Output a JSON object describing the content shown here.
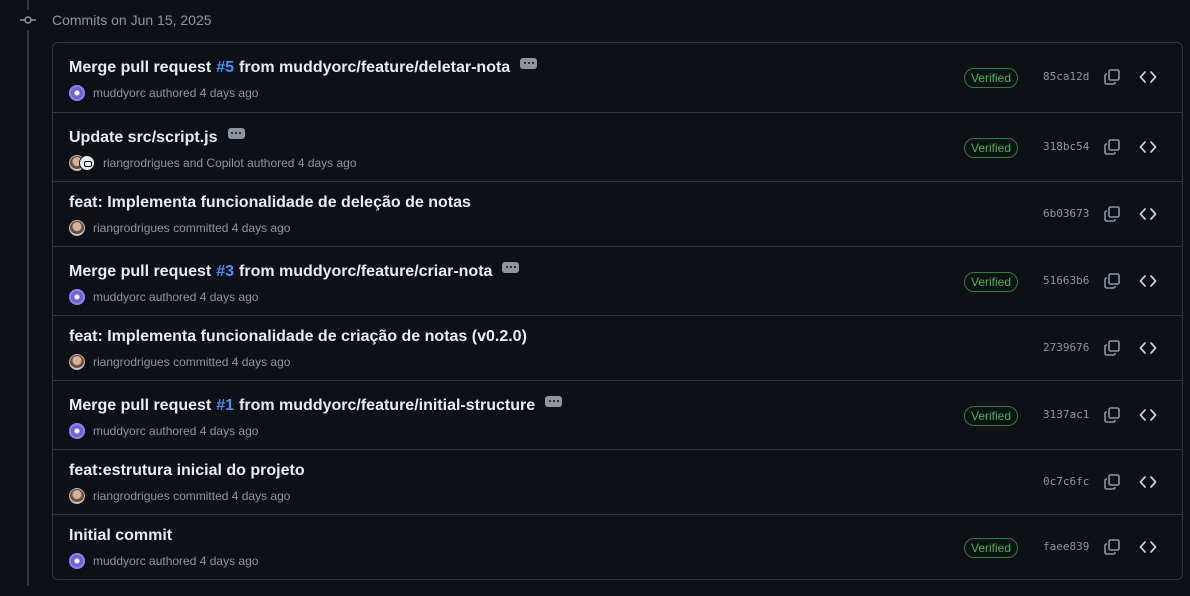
{
  "group": {
    "date_label": "Commits on Jun 15, 2025"
  },
  "commits": [
    {
      "title_before": "Merge pull request",
      "pr": "#5",
      "title_after": "from muddyorc/feature/deletar-nota",
      "has_ellipsis": true,
      "authors": "muddyorc",
      "action": "authored 4 days ago",
      "avatar": "muddy",
      "verified": "Verified",
      "sha": "85ca12d"
    },
    {
      "title_before": "Update src/script.js",
      "pr": "",
      "title_after": "",
      "has_ellipsis": true,
      "authors": "riangrodrigues and Copilot",
      "action": "authored 4 days ago",
      "avatar": "rian+copilot",
      "verified": "Verified",
      "sha": "318bc54"
    },
    {
      "title_before": "feat: Implementa funcionalidade de deleção de notas",
      "pr": "",
      "title_after": "",
      "has_ellipsis": false,
      "authors": "riangrodrigues",
      "action": "committed 4 days ago",
      "avatar": "rian",
      "verified": "",
      "sha": "6b03673"
    },
    {
      "title_before": "Merge pull request",
      "pr": "#3",
      "title_after": "from muddyorc/feature/criar-nota",
      "has_ellipsis": true,
      "authors": "muddyorc",
      "action": "authored 4 days ago",
      "avatar": "muddy",
      "verified": "Verified",
      "sha": "51663b6"
    },
    {
      "title_before": "feat: Implementa funcionalidade de criação de notas (v0.2.0)",
      "pr": "",
      "title_after": "",
      "has_ellipsis": false,
      "authors": "riangrodrigues",
      "action": "committed 4 days ago",
      "avatar": "rian",
      "verified": "",
      "sha": "2739676"
    },
    {
      "title_before": "Merge pull request",
      "pr": "#1",
      "title_after": "from muddyorc/feature/initial-structure",
      "has_ellipsis": true,
      "authors": "muddyorc",
      "action": "authored 4 days ago",
      "avatar": "muddy",
      "verified": "Verified",
      "sha": "3137ac1"
    },
    {
      "title_before": "feat:estrutura inicial do projeto",
      "pr": "",
      "title_after": "",
      "has_ellipsis": false,
      "authors": "riangrodrigues",
      "action": "committed 4 days ago",
      "avatar": "rian",
      "verified": "",
      "sha": "0c7c6fc"
    },
    {
      "title_before": "Initial commit",
      "pr": "",
      "title_after": "",
      "has_ellipsis": false,
      "authors": "muddyorc",
      "action": "authored 4 days ago",
      "avatar": "muddy",
      "verified": "Verified",
      "sha": "faee839"
    }
  ],
  "icons": {
    "commit_node": "git-commit-icon",
    "ellipsis": "kebab-horizontal-icon",
    "copy": "copy-icon",
    "browse": "code-icon"
  },
  "colors": {
    "background": "#0d1117",
    "border": "#30363d",
    "link": "#4493f8",
    "verified": "#3fb950",
    "muted": "#8d96a0"
  }
}
